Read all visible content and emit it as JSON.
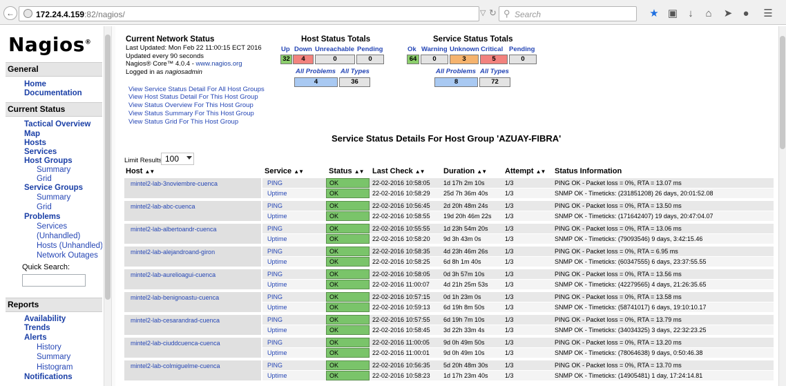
{
  "browser": {
    "url_host": "172.24.4.159",
    "url_rest": ":82/nagios/",
    "search_placeholder": "Search"
  },
  "sidebar": {
    "logo": "Nagios",
    "general_header": "General",
    "general_links": [
      "Home",
      "Documentation"
    ],
    "current_status_header": "Current Status",
    "tactical": "Tactical Overview",
    "map": "Map",
    "hosts": "Hosts",
    "services": "Services",
    "host_groups": "Host Groups",
    "hg_summary": "Summary",
    "hg_grid": "Grid",
    "service_groups": "Service Groups",
    "sg_summary": "Summary",
    "sg_grid": "Grid",
    "problems": "Problems",
    "p_services": "Services",
    "p_unhandled": "(Unhandled)",
    "p_hosts": "Hosts",
    "p_hosts_unhandled": "(Unhandled)",
    "p_outages": "Network Outages",
    "quick_search": "Quick Search:",
    "reports_header": "Reports",
    "availability": "Availability",
    "trends": "Trends",
    "alerts": "Alerts",
    "a_history": "History",
    "a_summary": "Summary",
    "a_histogram": "Histogram",
    "notifications": "Notifications"
  },
  "info": {
    "title": "Current Network Status",
    "updated": "Last Updated: Mon Feb 22 11:00:15 ECT 2016",
    "interval": "Updated every 90 seconds",
    "version_prefix": "Nagios® Core™ 4.0.4 - ",
    "version_link": "www.nagios.org",
    "logged_prefix": "Logged in as ",
    "user": "nagiosadmin",
    "links": [
      "View Service Status Detail For All Host Groups",
      "View Host Status Detail For This Host Group",
      "View Status Overview For This Host Group",
      "View Status Summary For This Host Group",
      "View Status Grid For This Host Group"
    ]
  },
  "host_totals": {
    "title": "Host Status Totals",
    "labels": [
      "Up",
      "Down",
      "Unreachable",
      "Pending"
    ],
    "values": [
      "32",
      "4",
      "0",
      "0"
    ],
    "sub_labels": [
      "All Problems",
      "All Types"
    ],
    "sub_values": [
      "4",
      "36"
    ]
  },
  "service_totals": {
    "title": "Service Status Totals",
    "labels": [
      "Ok",
      "Warning",
      "Unknown",
      "Critical",
      "Pending"
    ],
    "values": [
      "64",
      "0",
      "3",
      "5",
      "0"
    ],
    "sub_labels": [
      "All Problems",
      "All Types"
    ],
    "sub_values": [
      "8",
      "72"
    ]
  },
  "page_title": "Service Status Details For Host Group 'AZUAY-FIBRA'",
  "limit": {
    "label": "Limit Results:",
    "value": "100"
  },
  "table": {
    "headers": [
      "Host",
      "Service",
      "Status",
      "Last Check",
      "Duration",
      "Attempt",
      "Status Information"
    ],
    "rows": [
      {
        "host": "mintel2-lab-3noviembre-cuenca",
        "service": "PING",
        "status": "OK",
        "last": "22-02-2016 10:58:05",
        "dur": "1d 17h 2m 10s",
        "att": "1/3",
        "info": "PING OK - Packet loss = 0%, RTA = 13.07 ms"
      },
      {
        "host": "",
        "service": "Uptime",
        "status": "OK",
        "last": "22-02-2016 10:58:29",
        "dur": "25d 7h 36m 40s",
        "att": "1/3",
        "info": "SNMP OK - Timeticks: (231851208) 26 days, 20:01:52.08"
      },
      {
        "host": "mintel2-lab-abc-cuenca",
        "service": "PING",
        "status": "OK",
        "last": "22-02-2016 10:56:45",
        "dur": "2d 20h 48m 24s",
        "att": "1/3",
        "info": "PING OK - Packet loss = 0%, RTA = 13.50 ms"
      },
      {
        "host": "",
        "service": "Uptime",
        "status": "OK",
        "last": "22-02-2016 10:58:55",
        "dur": "19d 20h 46m 22s",
        "att": "1/3",
        "info": "SNMP OK - Timeticks: (171642407) 19 days, 20:47:04.07"
      },
      {
        "host": "mintel2-lab-albertoandr-cuenca",
        "service": "PING",
        "status": "OK",
        "last": "22-02-2016 10:55:55",
        "dur": "1d 23h 54m 20s",
        "att": "1/3",
        "info": "PING OK - Packet loss = 0%, RTA = 13.06 ms"
      },
      {
        "host": "",
        "service": "Uptime",
        "status": "OK",
        "last": "22-02-2016 10:58:20",
        "dur": "9d 3h 43m 0s",
        "att": "1/3",
        "info": "SNMP OK - Timeticks: (79093546) 9 days, 3:42:15.46"
      },
      {
        "host": "mintel2-lab-alejandroand-giron",
        "service": "PING",
        "status": "OK",
        "last": "22-02-2016 10:58:35",
        "dur": "4d 23h 46m 26s",
        "att": "1/3",
        "info": "PING OK - Packet loss = 0%, RTA = 6.95 ms"
      },
      {
        "host": "",
        "service": "Uptime",
        "status": "OK",
        "last": "22-02-2016 10:58:25",
        "dur": "6d 8h 1m 40s",
        "att": "1/3",
        "info": "SNMP OK - Timeticks: (60347555) 6 days, 23:37:55.55"
      },
      {
        "host": "mintel2-lab-aurelioagui-cuenca",
        "service": "PING",
        "status": "OK",
        "last": "22-02-2016 10:58:05",
        "dur": "0d 3h 57m 10s",
        "att": "1/3",
        "info": "PING OK - Packet loss = 0%, RTA = 13.56 ms"
      },
      {
        "host": "",
        "service": "Uptime",
        "status": "OK",
        "last": "22-02-2016 11:00:07",
        "dur": "4d 21h 25m 53s",
        "att": "1/3",
        "info": "SNMP OK - Timeticks: (42279565) 4 days, 21:26:35.65"
      },
      {
        "host": "mintel2-lab-benignoastu-cuenca",
        "service": "PING",
        "status": "OK",
        "last": "22-02-2016 10:57:15",
        "dur": "0d 1h 23m 0s",
        "att": "1/3",
        "info": "PING OK - Packet loss = 0%, RTA = 13.58 ms"
      },
      {
        "host": "",
        "service": "Uptime",
        "status": "OK",
        "last": "22-02-2016 10:59:13",
        "dur": "6d 19h 8m 50s",
        "att": "1/3",
        "info": "SNMP OK - Timeticks: (58741017) 6 days, 19:10:10.17"
      },
      {
        "host": "mintel2-lab-cesarandrad-cuenca",
        "service": "PING",
        "status": "OK",
        "last": "22-02-2016 10:57:55",
        "dur": "6d 19h 7m 10s",
        "att": "1/3",
        "info": "PING OK - Packet loss = 0%, RTA = 13.79 ms"
      },
      {
        "host": "",
        "service": "Uptime",
        "status": "OK",
        "last": "22-02-2016 10:58:45",
        "dur": "3d 22h 33m 4s",
        "att": "1/3",
        "info": "SNMP OK - Timeticks: (34034325) 3 days, 22:32:23.25"
      },
      {
        "host": "mintel2-lab-ciuddcuenca-cuenca",
        "service": "PING",
        "status": "OK",
        "last": "22-02-2016 11:00:05",
        "dur": "9d 0h 49m 50s",
        "att": "1/3",
        "info": "PING OK - Packet loss = 0%, RTA = 13.20 ms"
      },
      {
        "host": "",
        "service": "Uptime",
        "status": "OK",
        "last": "22-02-2016 11:00:01",
        "dur": "9d 0h 49m 10s",
        "att": "1/3",
        "info": "SNMP OK - Timeticks: (78064638) 9 days, 0:50:46.38"
      },
      {
        "host": "mintel2-lab-colmiguelme-cuenca",
        "service": "PING",
        "status": "OK",
        "last": "22-02-2016 10:56:35",
        "dur": "5d 20h 48m 30s",
        "att": "1/3",
        "info": "PING OK - Packet loss = 0%, RTA = 13.70 ms"
      },
      {
        "host": "",
        "service": "Uptime",
        "status": "OK",
        "last": "22-02-2016 10:58:23",
        "dur": "1d 17h 23m 40s",
        "att": "1/3",
        "info": "SNMP OK - Timeticks: (14905481) 1 day, 17:24:14.81"
      }
    ]
  }
}
